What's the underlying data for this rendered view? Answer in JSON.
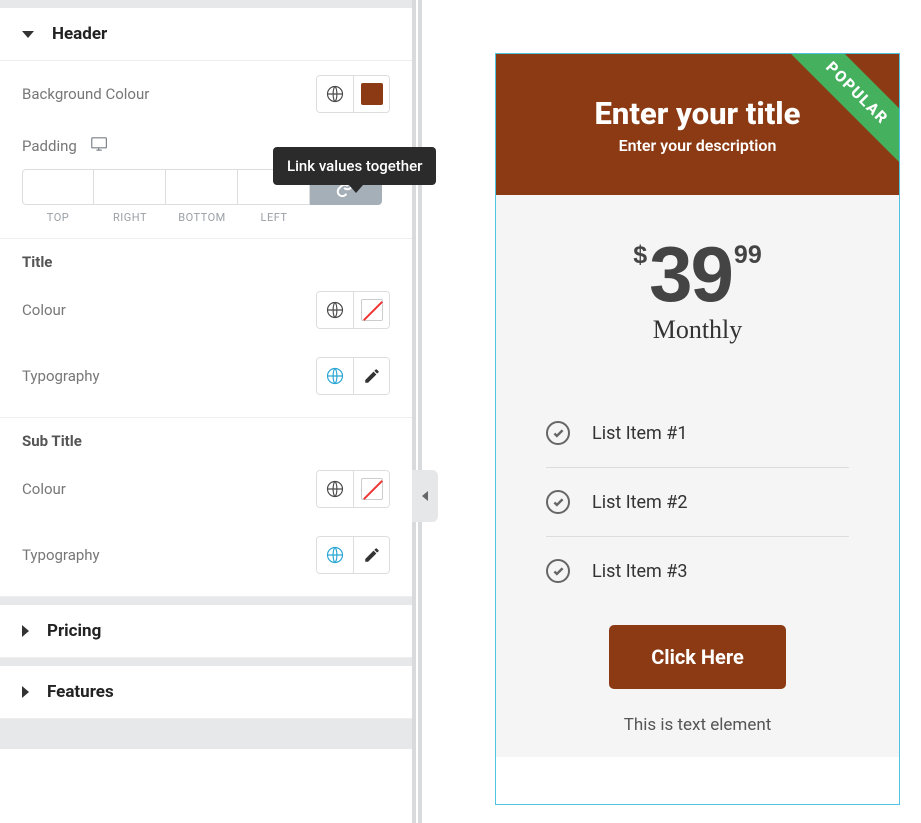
{
  "tooltip": {
    "link_values": "Link values together"
  },
  "sections": {
    "header": {
      "title": "Header",
      "bg_colour_label": "Background Colour",
      "bg_colour_value": "#8b3a13",
      "padding_label": "Padding",
      "side_labels": [
        "TOP",
        "RIGHT",
        "BOTTOM",
        "LEFT"
      ],
      "title_group": {
        "heading": "Title",
        "colour_label": "Colour",
        "typography_label": "Typography"
      },
      "subtitle_group": {
        "heading": "Sub Title",
        "colour_label": "Colour",
        "typography_label": "Typography"
      }
    },
    "pricing": {
      "title": "Pricing"
    },
    "features": {
      "title": "Features"
    }
  },
  "preview": {
    "header_bg": "#8b3a13",
    "ribbon_bg": "#45b15f",
    "ribbon_text": "POPULAR",
    "title": "Enter your title",
    "description": "Enter your description",
    "price_color": "#444444",
    "currency": "$",
    "amount": "39",
    "cents": "99",
    "period": "Monthly",
    "features": [
      "List Item #1",
      "List Item #2",
      "List Item #3"
    ],
    "cta_bg": "#8b3a13",
    "cta_label": "Click Here",
    "footnote": "This is text element"
  }
}
